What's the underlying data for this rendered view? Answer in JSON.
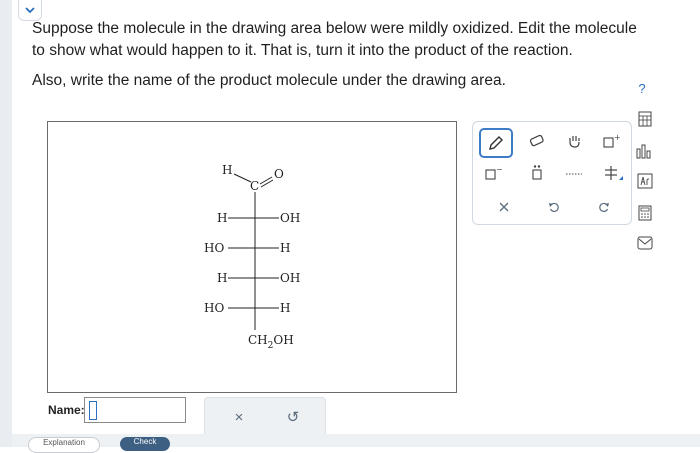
{
  "question": {
    "paragraph1": "Suppose the molecule in the drawing area below were mildly oxidized. Edit the molecule to show what would happen to it. That is, turn it into the product of the reaction.",
    "paragraph2": "Also, write the name of the product molecule under the drawing area."
  },
  "help": {
    "label": "?"
  },
  "molecule": {
    "aldehyde_h": "H",
    "aldehyde_c": "C",
    "aldehyde_o": "O",
    "rows": [
      {
        "left": "H",
        "right": "OH"
      },
      {
        "left": "HO",
        "right": "H"
      },
      {
        "left": "H",
        "right": "OH"
      },
      {
        "left": "HO",
        "right": "H"
      }
    ],
    "bottom_group": "CH",
    "bottom_sub": "2",
    "bottom_suffix": "OH"
  },
  "toolbar": {
    "row1": [
      "pencil-icon",
      "eraser-icon",
      "hand-icon",
      "charge-plus-icon"
    ],
    "row2": [
      "charge-minus-icon",
      "lone-pair-icon",
      "dots-icon",
      "stereo-icon"
    ],
    "row3": [
      "clear-icon",
      "undo-icon",
      "redo-icon"
    ],
    "plus": "+",
    "minus": "−"
  },
  "side": [
    "periodic-table-icon",
    "bars-icon",
    "text-ar-icon",
    "calculator-icon",
    "message-icon"
  ],
  "name_field": {
    "label": "Name:",
    "value": ""
  },
  "actions": {
    "clear": "×",
    "undo": "↺"
  },
  "bottom": {
    "explanation": "Explanation",
    "check": "Check"
  },
  "colors": {
    "accent": "#2b6fbf",
    "check_bg": "#3c5f82"
  }
}
